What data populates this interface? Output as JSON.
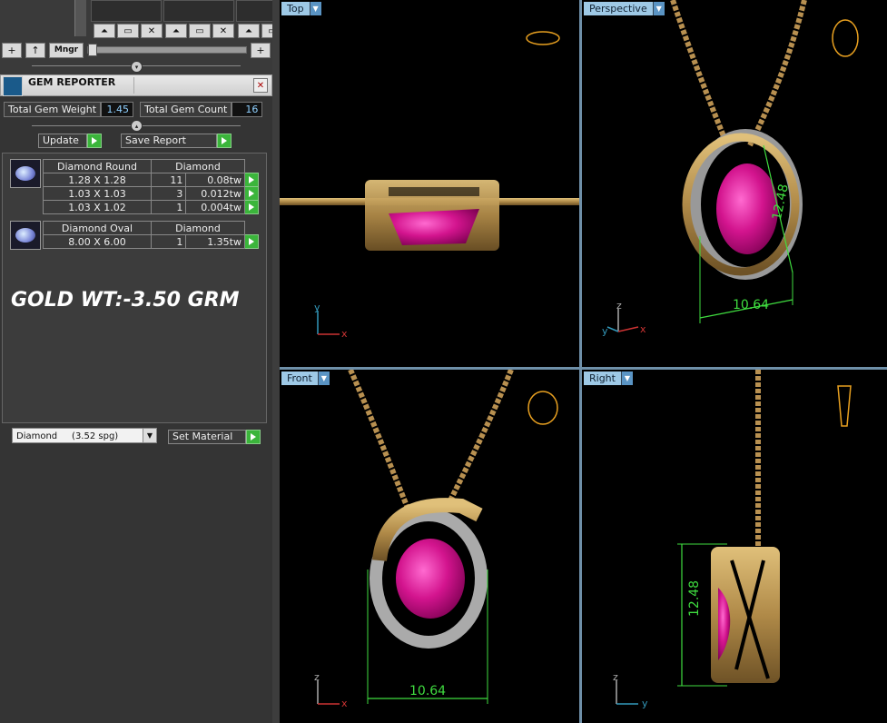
{
  "toolbar": {
    "mngr_label": "Mngr",
    "add_label": "+",
    "up_label": "↑"
  },
  "gem_reporter": {
    "title": "GEM REPORTER",
    "total_weight_label": "Total Gem Weight",
    "total_weight_value": "1.45",
    "total_count_label": "Total Gem Count",
    "total_count_value": "16",
    "update_label": "Update",
    "save_report_label": "Save Report",
    "groups": [
      {
        "shape": "Diamond Round",
        "material": "Diamond",
        "rows": [
          {
            "size": "1.28 X 1.28",
            "count": "11",
            "weight": "0.08tw"
          },
          {
            "size": "1.03 X 1.03",
            "count": "3",
            "weight": "0.012tw"
          },
          {
            "size": "1.03 X 1.02",
            "count": "1",
            "weight": "0.004tw"
          }
        ]
      },
      {
        "shape": "Diamond Oval",
        "material": "Diamond",
        "rows": [
          {
            "size": "8.00 X 6.00",
            "count": "1",
            "weight": "1.35tw"
          }
        ]
      }
    ],
    "gold_note": "GOLD WT:-3.50 GRM",
    "material_select": "Diamond     (3.52 spg)",
    "set_material_label": "Set Material"
  },
  "viewports": {
    "top": {
      "label": "Top",
      "axis_a": "y",
      "axis_b": "x"
    },
    "perspective": {
      "label": "Perspective",
      "axis_a": "z",
      "axis_b": "x",
      "axis_c": "y",
      "dim_width": "10.64",
      "dim_height": "12.48"
    },
    "front": {
      "label": "Front",
      "axis_a": "z",
      "axis_b": "x",
      "dim_width": "10.64"
    },
    "right": {
      "label": "Right",
      "axis_a": "z",
      "axis_b": "y",
      "dim_height": "12.48"
    }
  }
}
